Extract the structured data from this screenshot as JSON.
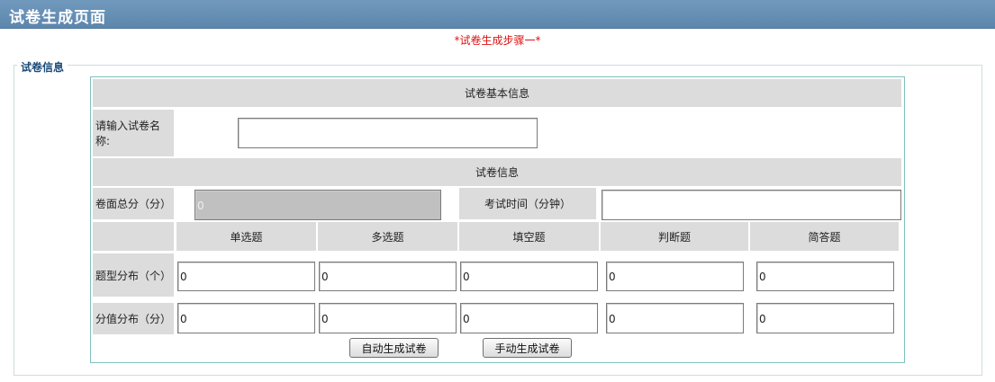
{
  "page": {
    "title": "试卷生成页面",
    "step_text": "*试卷生成步骤一*"
  },
  "fieldset": {
    "legend": "试卷信息"
  },
  "basic": {
    "header": "试卷基本信息",
    "name_label": "请输入试卷名称:",
    "name_value": ""
  },
  "info": {
    "header": "试卷信息",
    "total_label": "卷面总分（分）",
    "total_value": "0",
    "time_label": "考试时间（分钟）",
    "time_value": ""
  },
  "types": [
    "单选题",
    "多选题",
    "填空题",
    "判断题",
    "简答题"
  ],
  "distribution": {
    "label": "题型分布（个）",
    "values": [
      "0",
      "0",
      "0",
      "0",
      "0"
    ]
  },
  "scores": {
    "label": "分值分布（分）",
    "values": [
      "0",
      "0",
      "0",
      "0",
      "0"
    ]
  },
  "buttons": {
    "auto": "自动生成试卷",
    "manual": "手动生成试卷"
  }
}
